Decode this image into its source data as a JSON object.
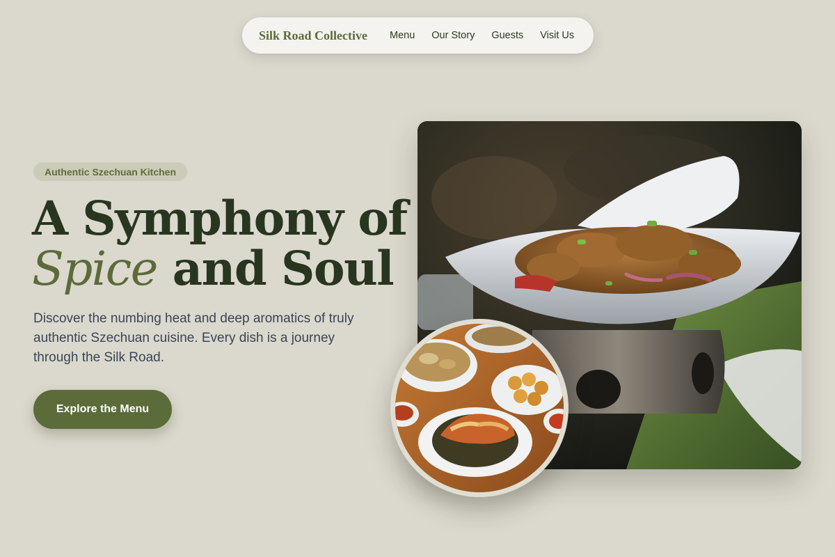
{
  "nav": {
    "brand": "Silk Road Collective",
    "links": [
      "Menu",
      "Our Story",
      "Guests",
      "Visit Us"
    ]
  },
  "hero": {
    "badge": "Authentic Szechuan Kitchen",
    "headline_line1": "A Symphony of",
    "headline_emphasis": "Spice",
    "headline_line2_rest": " and Soul",
    "subtext": "Discover the numbing heat and deep aromatics of truly authentic Szechuan cuisine. Every dish is a journey through the Silk Road.",
    "cta_label": "Explore the Menu"
  },
  "images": {
    "main_photo_icon": "sizzling-dish-photo",
    "round_photo_icon": "banquet-table-photo"
  },
  "colors": {
    "background": "#dbd8cd",
    "accent": "#5b6b3a",
    "headline": "#283620",
    "nav_bg": "#f4f3ef",
    "badge_bg": "#cbccb8"
  }
}
